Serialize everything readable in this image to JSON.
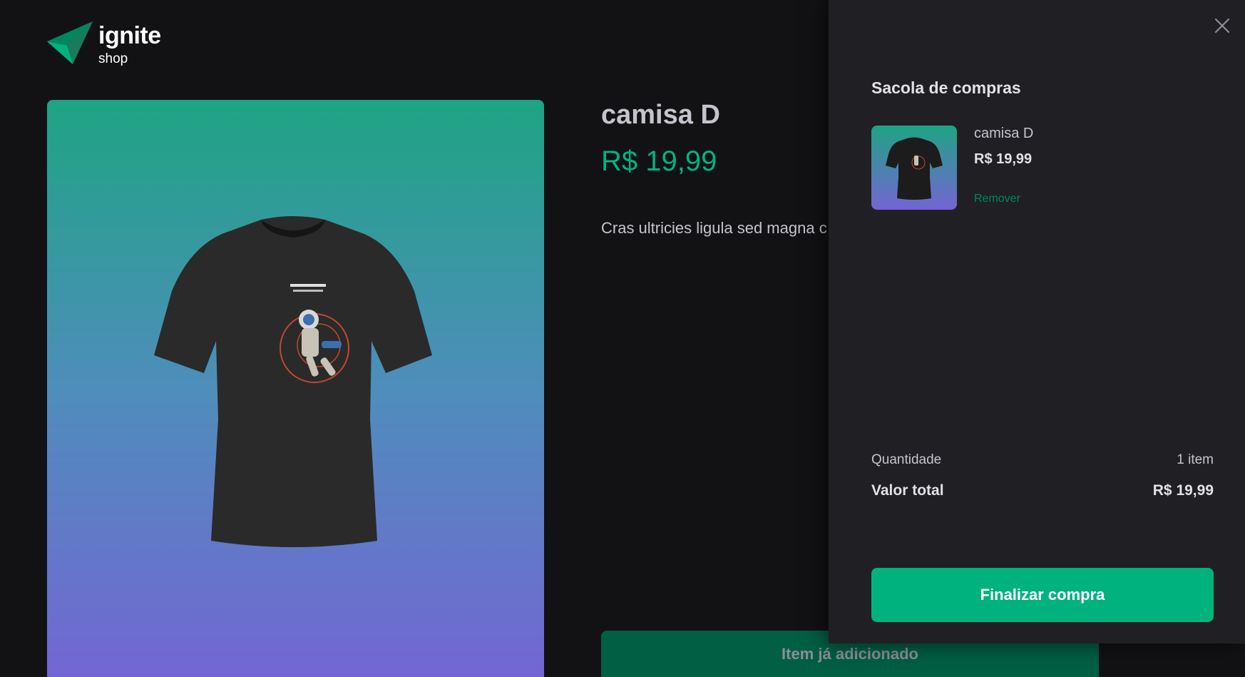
{
  "brand": {
    "logo_icon": "ignite-triangle-logo",
    "title": "ignite",
    "subtitle": "shop"
  },
  "product": {
    "image_icon": "black-tshirt-astronaut-print",
    "title": "camisa D",
    "price": "R$ 19,99",
    "description": "Cras ultricies ligula sed magna c convallis a pellentesque nec, eg",
    "button_label": "Item já adicionado"
  },
  "cart": {
    "close_icon": "close-icon",
    "title": "Sacola de compras",
    "items": [
      {
        "name": "camisa D",
        "price": "R$ 19,99",
        "remove_label": "Remover"
      }
    ],
    "quantity_label": "Quantidade",
    "quantity_value": "1 item",
    "total_label": "Valor total",
    "total_value": "R$ 19,99",
    "checkout_label": "Finalizar compra"
  },
  "colors": {
    "background": "#121214",
    "drawer": "#202024",
    "accent": "#00b37e",
    "accent_dark": "#015f43"
  }
}
